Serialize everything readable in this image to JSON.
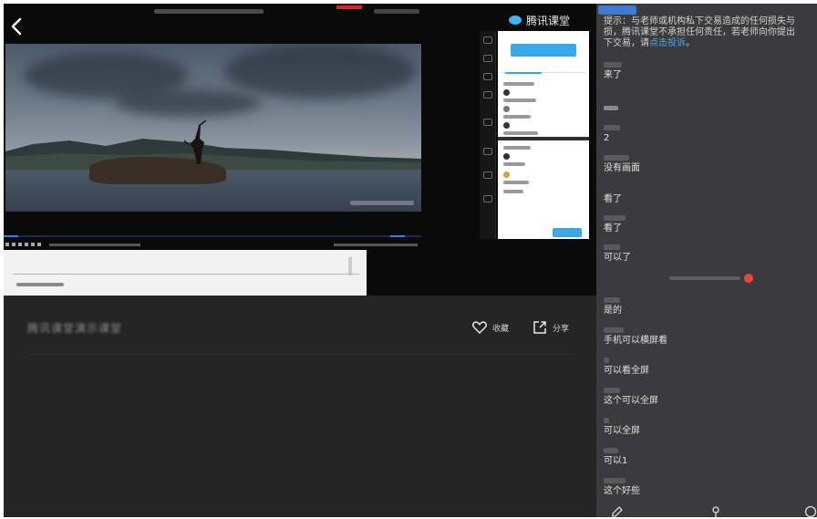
{
  "header": {
    "back_label": "<"
  },
  "mini_classroom": {
    "brand": "腾讯课堂"
  },
  "course": {
    "title": "腾讯课堂演示课堂"
  },
  "actions": {
    "favorite_label": "收藏",
    "share_label": "分享"
  },
  "chat": {
    "notice_prefix": "提示：与老师或机构私下交易造成的任何损失与",
    "notice_line2": "损，腾讯课堂不承担任何责任，若老师向你提出",
    "notice_line3_before": "下交易，请",
    "notice_link": "点击投诉",
    "notice_line3_after": "。",
    "messages": [
      {
        "text": "来了"
      },
      {
        "text": ""
      },
      {
        "text": "2"
      },
      {
        "text": "没有画面"
      },
      {
        "text": "看了"
      },
      {
        "text": "看了"
      },
      {
        "text": "可以了"
      },
      {
        "text": "是的"
      },
      {
        "text": "手机可以横屏看"
      },
      {
        "text": "可以看全屏"
      },
      {
        "text": "这个可以全屏"
      },
      {
        "text": "可以全屏"
      },
      {
        "text": "可以1"
      },
      {
        "text": "这个好些"
      }
    ]
  },
  "colors": {
    "accent_blue": "#2f7fff",
    "chat_bg": "#3b3b3d",
    "video_bg": "#0a0a0a",
    "notify_red": "#e8453c"
  }
}
